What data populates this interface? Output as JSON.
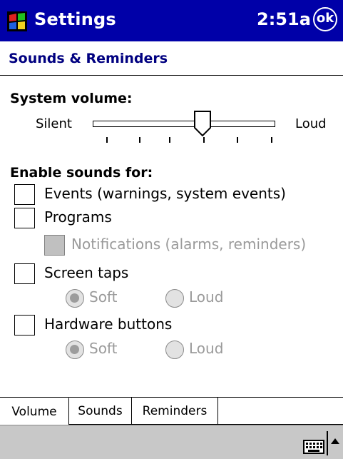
{
  "titlebar": {
    "app_title": "Settings",
    "time": "2:51a",
    "ok_label": "ok",
    "bg_color": "#0000a8",
    "start_icon": "windows-flag-icon"
  },
  "page": {
    "title": "Sounds & Reminders"
  },
  "volume": {
    "label": "System volume:",
    "min_label": "Silent",
    "max_label": "Loud",
    "level_fraction": 0.6,
    "tick_count": 6
  },
  "enable": {
    "label": "Enable sounds for:",
    "events": {
      "label": "Events (warnings, system events)",
      "checked": false
    },
    "programs": {
      "label": "Programs",
      "checked": false
    },
    "notifications": {
      "label": "Notifications (alarms, reminders)",
      "checked": false,
      "disabled": true
    },
    "screen_taps": {
      "label": "Screen taps",
      "checked": false,
      "soft_label": "Soft",
      "loud_label": "Loud",
      "selected": "Soft"
    },
    "hardware_buttons": {
      "label": "Hardware buttons",
      "checked": false,
      "soft_label": "Soft",
      "loud_label": "Loud",
      "selected": "Soft"
    }
  },
  "tabs": [
    {
      "label": "Volume",
      "active": true
    },
    {
      "label": "Sounds",
      "active": false
    },
    {
      "label": "Reminders",
      "active": false
    }
  ],
  "menubar": {
    "input_icon": "keyboard-icon",
    "sip_icon": "arrow-up-icon"
  }
}
